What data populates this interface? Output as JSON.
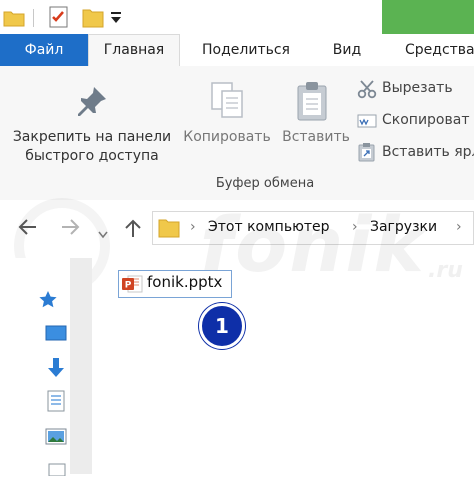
{
  "tabs": {
    "file": "Файл",
    "home": "Главная",
    "share": "Поделиться",
    "view": "Вид",
    "tools": "Средства"
  },
  "ribbon": {
    "pin_line1": "Закрепить на панели",
    "pin_line2": "быстрого доступа",
    "copy": "Копировать",
    "paste": "Вставить",
    "cut": "Вырезать",
    "copy_path": "Скопироват",
    "paste_shortcut": "Вставить ярл",
    "group_clipboard": "Буфер обмена"
  },
  "nav": {
    "breadcrumb_sep": "›",
    "crumb_computer": "Этот компьютер",
    "crumb_downloads": "Загрузки"
  },
  "file": {
    "name": "fonik.pptx"
  },
  "annotation": {
    "step": "1"
  },
  "watermark": {
    "text": "fonik",
    "suffix": ".ru"
  },
  "colors": {
    "file_tab": "#1e6ec8",
    "tools_tab": "#5bb352",
    "badge": "#0e2fa8"
  }
}
